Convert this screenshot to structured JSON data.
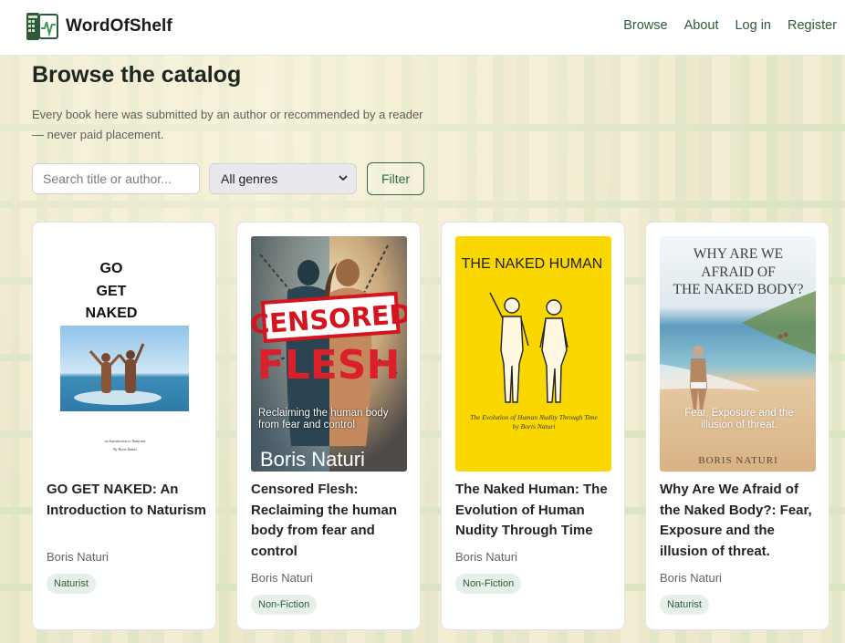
{
  "brand": {
    "name": "WordOfShelf",
    "logo_icon": "book-ledger-chart-logo"
  },
  "nav": {
    "browse": "Browse",
    "about": "About",
    "login": "Log in",
    "register": "Register"
  },
  "page": {
    "title": "Browse the catalog",
    "subtitle": "Every book here was submitted by an author or recommended by a reader — never paid placement."
  },
  "filters": {
    "search_placeholder": "Search title or author...",
    "genre_selected": "All genres",
    "filter_label": "Filter"
  },
  "books": [
    {
      "title": "GO GET NAKED: An Introduction to Naturism",
      "author": "Boris Naturi",
      "genre": "Naturist",
      "cover": {
        "line1": "GO",
        "line2": "GET",
        "line3": "NAKED",
        "tagline": "an Introduction to Naturism",
        "author": "By Boris Naturi"
      }
    },
    {
      "title": "Censored Flesh: Reclaiming the human body from fear and control",
      "author": "Boris Naturi",
      "genre": "Non-Fiction",
      "cover": {
        "stamp": "CENSORED",
        "big": "FLESH",
        "subtitle": "Reclaiming the human body from fear and control",
        "author": "Boris Naturi"
      }
    },
    {
      "title": "The Naked Human: The Evolution of Human Nudity Through Time",
      "author": "Boris Naturi",
      "genre": "Non-Fiction",
      "cover": {
        "title": "THE NAKED HUMAN",
        "subtitle": "The Evolution of Human Nudity Through Time",
        "author": "by Boris Naturi"
      }
    },
    {
      "title": "Why Are We Afraid of the Naked Body?: Fear, Exposure and the illusion of threat.",
      "author": "Boris Naturi",
      "genre": "Naturist",
      "cover": {
        "title_l1": "WHY ARE WE",
        "title_l2": "AFRAID OF",
        "title_l3": "THE NAKED BODY?",
        "subtitle": "Fear, Exposure and the illusion of threat.",
        "author": "BORIS NATURI"
      }
    }
  ]
}
